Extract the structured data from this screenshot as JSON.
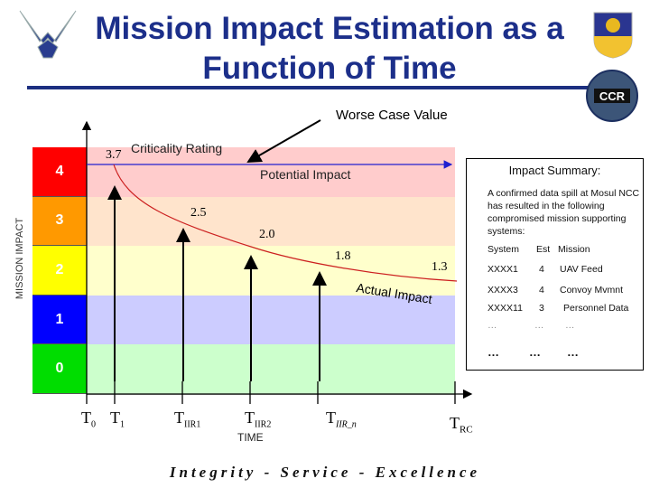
{
  "title": "Mission Impact Estimation as a Function of Time",
  "logos": [
    "air-force-wings-logo",
    "wing-shield-emblem",
    "ccr-seal"
  ],
  "annotation": {
    "worse_case": "Worse Case Value",
    "criticality": "Criticality Rating",
    "potential": "Potential Impact",
    "actual": "Actual Impact"
  },
  "y_axis_label": "MISSION IMPACT",
  "x_axis_label": "TIME",
  "levels": [
    {
      "label": "4",
      "color": "#ff0000",
      "band": "#ffcccc"
    },
    {
      "label": "3",
      "color": "#ff9900",
      "band": "#ffe4cc"
    },
    {
      "label": "2",
      "color": "#ffff00",
      "band": "#ffffcc"
    },
    {
      "label": "1",
      "color": "#0000ff",
      "band": "#ccccff"
    },
    {
      "label": "0",
      "color": "#00dd00",
      "band": "#ccffcc"
    }
  ],
  "time_ticks": [
    {
      "main": "T",
      "sub": "0"
    },
    {
      "main": "T",
      "sub": "1"
    },
    {
      "main": "T",
      "sub": "IIR1"
    },
    {
      "main": "T",
      "sub": "IIR2"
    },
    {
      "main": "T",
      "sub": "IIR_n"
    },
    {
      "main": "T",
      "sub": "RC"
    }
  ],
  "impact_values": [
    "3.7",
    "2.5",
    "2.0",
    "1.8",
    "1.3"
  ],
  "summary": {
    "heading": "Impact Summary:",
    "text": "A confirmed data spill at Mosul NCC has resulted in the following compromised mission supporting systems:",
    "columns": [
      "System",
      "Est",
      "Mission"
    ],
    "rows": [
      [
        "XXXX1",
        "4",
        "UAV Feed"
      ],
      [
        "XXXX3",
        "4",
        "Convoy Mvmnt"
      ],
      [
        "XXXX11",
        "3",
        "Personnel Data"
      ],
      [
        "…",
        "…",
        "…"
      ],
      [
        "…",
        "…",
        "…"
      ]
    ]
  },
  "footer": "Integrity - Service - Excellence"
}
